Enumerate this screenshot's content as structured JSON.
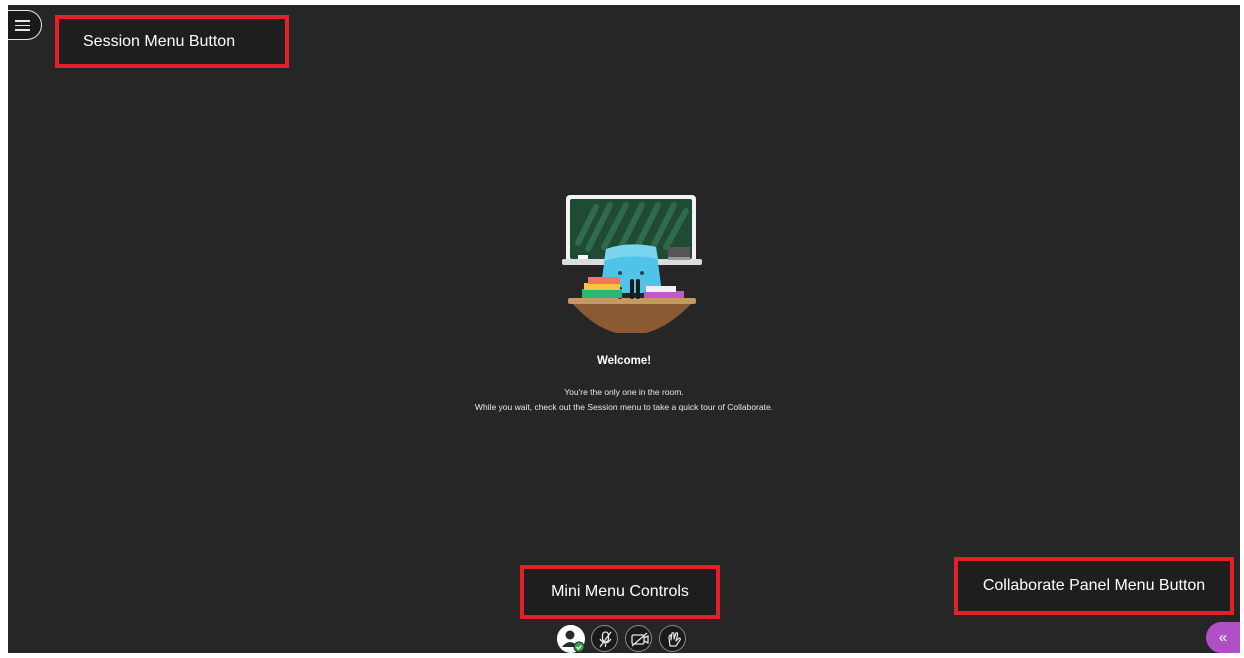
{
  "callouts": {
    "session_menu": "Session Menu Button",
    "mini_menu": "Mini Menu Controls",
    "panel_menu": "Collaborate Panel Menu Button"
  },
  "welcome": {
    "title": "Welcome!",
    "line1": "You're the only one in the room.",
    "line2": "While you wait, check out the Session menu to take a quick tour of Collaborate."
  },
  "controls": [
    {
      "name": "profile",
      "icon": "avatar-icon"
    },
    {
      "name": "audio",
      "icon": "microphone-muted-icon"
    },
    {
      "name": "video",
      "icon": "camera-off-icon"
    },
    {
      "name": "hand",
      "icon": "raise-hand-icon"
    }
  ],
  "panel_button": {
    "glyph": "«",
    "icon": "double-chevron-left-icon"
  },
  "colors": {
    "background": "#262626",
    "callout_border": "#e3202a",
    "panel_button": "#b14fc5",
    "status_green": "#2ea44f"
  }
}
